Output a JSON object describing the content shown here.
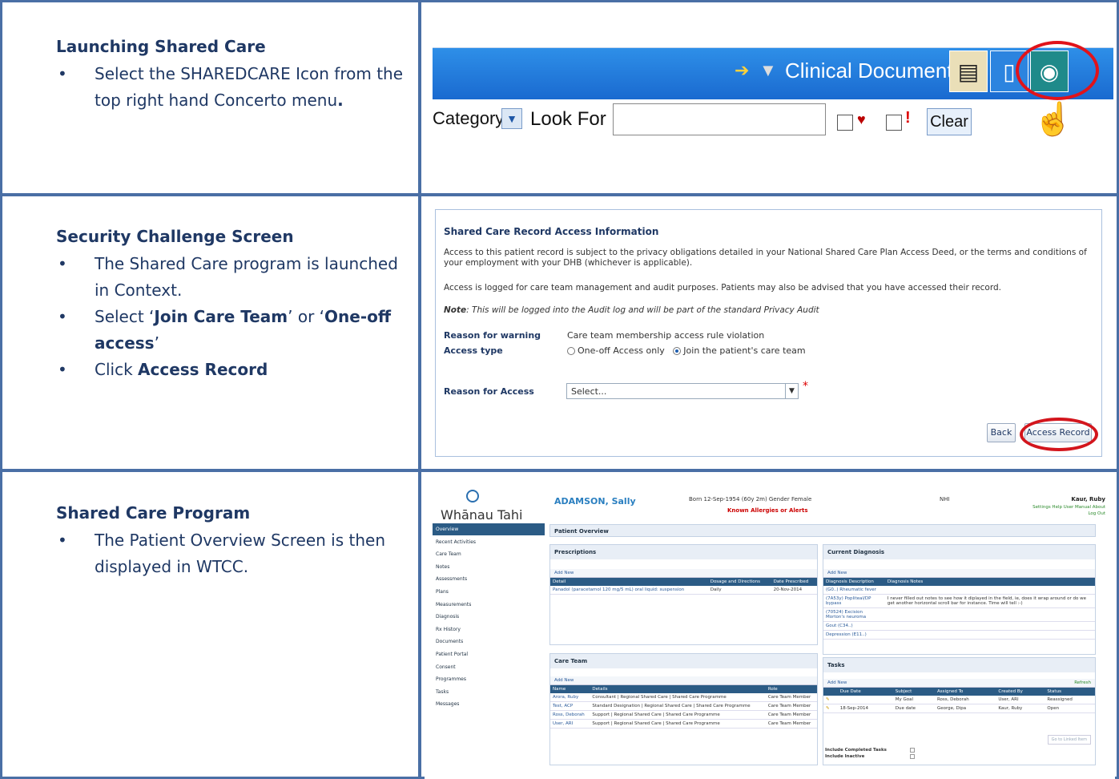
{
  "rows": [
    {
      "heading": "Launching Shared Care",
      "bullets": [
        {
          "pre": "Select the SHAREDCARE Icon from the top right hand Concerto menu",
          "b1": "",
          "mid": "",
          "b2": "",
          "post": "."
        }
      ]
    },
    {
      "heading": "Security Challenge Screen",
      "bullets": [
        {
          "pre": "The Shared Care program is launched in Context.",
          "b1": "",
          "mid": "",
          "b2": "",
          "post": ""
        },
        {
          "pre": "Select ‘",
          "b1": "Join Care Team",
          "mid": "’ or ‘",
          "b2": "One-off access",
          "post": "’"
        },
        {
          "pre": "Click ",
          "b1": "Access Record",
          "mid": "",
          "b2": "",
          "post": ""
        }
      ]
    },
    {
      "heading": "Shared Care Program",
      "bullets": [
        {
          "pre": "The Patient Overview Screen is then displayed in WTCC.",
          "b1": "",
          "mid": "",
          "b2": "",
          "post": ""
        }
      ]
    }
  ],
  "concerto": {
    "menu_title": "Clinical Documents",
    "category_label": "Category",
    "look_for_label": "Look For",
    "clear_button": "Clear",
    "colors": {
      "bar": "#1a6ad0",
      "highlight_ring": "#e1131a"
    }
  },
  "access_form": {
    "title": "Shared Care Record Access Information",
    "para1": "Access to this patient record is subject to the privacy obligations detailed in your National Shared Care Plan Access Deed, or the terms and conditions of your employment with your DHB (whichever is applicable).",
    "para2": "Access is logged for care team management and audit purposes. Patients may also be advised that you have accessed their record.",
    "note_label": "Note",
    "note_text": ": This will be logged into the Audit log and will be part of the standard Privacy Audit",
    "reason_warning_label": "Reason for warning",
    "reason_warning_value": "Care team membership access rule violation",
    "access_type_label": "Access type",
    "option_oneoff": "One-off Access only",
    "option_join": "Join the patient's care team",
    "selected_option": "join",
    "reason_access_label": "Reason for Access",
    "reason_access_placeholder": "Select...",
    "required_mark": "*",
    "back_button": "Back",
    "access_button": "Access Record"
  },
  "wtcc": {
    "logo": "Whānau Tahi",
    "patient_name": "ADAMSON, Sally",
    "born": "Born  12-Sep-1954 (60y 2m)   Gender  Female",
    "alert": "Known Allergies or Alerts",
    "nhi_label": "NHI",
    "user": "Kaur, Ruby",
    "links": "Settings   Help   User Manual   About",
    "logout": "Log Out",
    "nav": [
      "Overview",
      "Recent Activities",
      "Care Team",
      "Notes",
      "Assessments",
      "Plans",
      "Measurements",
      "Diagnosis",
      "Rx History",
      "Documents",
      "Patient Portal",
      "Consent",
      "Programmes",
      "Tasks",
      "Messages"
    ],
    "page_title": "Patient Overview",
    "add_new": "Add New",
    "prescriptions": {
      "title": "Prescriptions",
      "headers": [
        "Detail",
        "Dosage and Directions",
        "Date Prescribed"
      ],
      "rows": [
        [
          "Panadol (paracetamol 120 mg/5 mL) oral liquid: suspension",
          "Daily",
          "20-Nov-2014"
        ]
      ]
    },
    "diagnosis": {
      "title": "Current Diagnosis",
      "headers": [
        "Diagnosis Description",
        "Diagnosis Notes"
      ],
      "rows": [
        [
          "(G0..) Rheumatic fever",
          ""
        ],
        [
          "(7A53y) Popliteal/DP bypass",
          "I never filled out notes to see how it diplayed in the field, ie, does it wrap around or do we get another horizontal scroll bar for instance. Time will tell :-)"
        ],
        [
          "(70524) Excision Morton's neuroma",
          ""
        ],
        [
          "Gout (C34..)",
          ""
        ],
        [
          "Depression (E11..)",
          ""
        ]
      ]
    },
    "care_team": {
      "title": "Care Team",
      "headers": [
        "Name",
        "Details",
        "Role"
      ],
      "rows": [
        [
          "Arora, Ruby",
          "Consultant | Regional Shared Care | Shared Care Programme",
          "Care Team Member"
        ],
        [
          "Test, ACP",
          "Standard Designation | Regional Shared Care | Shared Care Programme",
          "Care Team Member"
        ],
        [
          "Ross, Deborah",
          "Support | Regional Shared Care | Shared Care Programme",
          "Care Team Member"
        ],
        [
          "User, ARI",
          "Support | Regional Shared Care | Shared Care Programme",
          "Care Team Member"
        ]
      ]
    },
    "tasks": {
      "title": "Tasks",
      "refresh": "Refresh",
      "headers": [
        "",
        "Due Date",
        "Subject",
        "Assigned To",
        "Created By",
        "Status"
      ],
      "rows": [
        [
          "",
          "",
          "My Goal",
          "Ross, Deborah",
          "User, ARI",
          "Reassigned"
        ],
        [
          "",
          "18-Sep-2014",
          "Due date",
          "George, Dipa",
          "Kaur, Ruby",
          "Open"
        ]
      ],
      "go_linked": "Go to Linked Item",
      "include_completed": "Include Completed Tasks",
      "include_inactive": "Include Inactive"
    }
  }
}
